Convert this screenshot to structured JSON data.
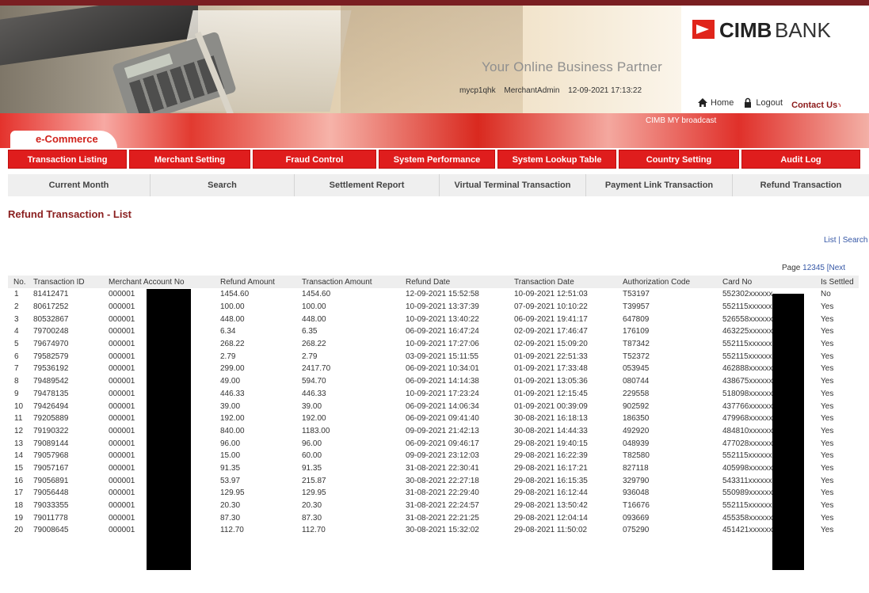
{
  "header": {
    "tagline": "Your Online Business Partner",
    "user_id": "mycp1qhk",
    "user_role": "MerchantAdmin",
    "datetime": "12-09-2021 17:13:22",
    "brand_name_bold": "CIMB",
    "brand_name_rest": "BANK",
    "links": {
      "home": "Home",
      "logout": "Logout",
      "contact": "Contact Us"
    }
  },
  "banner": {
    "section_tab": "e-Commerce",
    "broadcast": "CIMB MY broadcast"
  },
  "main_nav": [
    "Transaction Listing",
    "Merchant Setting",
    "Fraud Control",
    "System Performance",
    "System Lookup Table",
    "Country Setting",
    "Audit Log"
  ],
  "sub_nav": [
    "Current Month",
    "Search",
    "Settlement Report",
    "Virtual Terminal Transaction",
    "Payment Link Transaction",
    "Refund Transaction"
  ],
  "page": {
    "title": "Refund Transaction - List",
    "list_link": "List",
    "separator": " | ",
    "search_link": "Search",
    "pager_label": "Page",
    "pages": [
      "1",
      "2",
      "3",
      "4",
      "5"
    ],
    "next": "[Next"
  },
  "table": {
    "columns": [
      "No.",
      "Transaction ID",
      "Merchant Account No",
      "Refund Amount",
      "Transaction Amount",
      "Refund Date",
      "Transaction Date",
      "Authorization Code",
      "Card No",
      "Is Settled"
    ],
    "rows": [
      [
        "1",
        "81412471",
        "000001",
        "1454.60",
        "1454.60",
        "12-09-2021 15:52:58",
        "10-09-2021 12:51:03",
        "T53197",
        "552302xxxxxx",
        "No"
      ],
      [
        "2",
        "80617252",
        "000001",
        "100.00",
        "100.00",
        "10-09-2021 13:37:39",
        "07-09-2021 10:10:22",
        "T39957",
        "552115xxxxxx",
        "Yes"
      ],
      [
        "3",
        "80532867",
        "000001",
        "448.00",
        "448.00",
        "10-09-2021 13:40:22",
        "06-09-2021 19:41:17",
        "647809",
        "526558xxxxxx",
        "Yes"
      ],
      [
        "4",
        "79700248",
        "000001",
        "6.34",
        "6.35",
        "06-09-2021 16:47:24",
        "02-09-2021 17:46:47",
        "176109",
        "463225xxxxxx",
        "Yes"
      ],
      [
        "5",
        "79674970",
        "000001",
        "268.22",
        "268.22",
        "10-09-2021 17:27:06",
        "02-09-2021 15:09:20",
        "T87342",
        "552115xxxxxx",
        "Yes"
      ],
      [
        "6",
        "79582579",
        "000001",
        "2.79",
        "2.79",
        "03-09-2021 15:11:55",
        "01-09-2021 22:51:33",
        "T52372",
        "552115xxxxxx",
        "Yes"
      ],
      [
        "7",
        "79536192",
        "000001",
        "299.00",
        "2417.70",
        "06-09-2021 10:34:01",
        "01-09-2021 17:33:48",
        "053945",
        "462888xxxxxx",
        "Yes"
      ],
      [
        "8",
        "79489542",
        "000001",
        "49.00",
        "594.70",
        "06-09-2021 14:14:38",
        "01-09-2021 13:05:36",
        "080744",
        "438675xxxxxx",
        "Yes"
      ],
      [
        "9",
        "79478135",
        "000001",
        "446.33",
        "446.33",
        "10-09-2021 17:23:24",
        "01-09-2021 12:15:45",
        "229558",
        "518098xxxxxx",
        "Yes"
      ],
      [
        "10",
        "79426494",
        "000001",
        "39.00",
        "39.00",
        "06-09-2021 14:06:34",
        "01-09-2021 00:39:09",
        "902592",
        "437766xxxxxx",
        "Yes"
      ],
      [
        "11",
        "79205889",
        "000001",
        "192.00",
        "192.00",
        "06-09-2021 09:41:40",
        "30-08-2021 16:18:13",
        "186350",
        "479968xxxxxx",
        "Yes"
      ],
      [
        "12",
        "79190322",
        "000001",
        "840.00",
        "1183.00",
        "09-09-2021 21:42:13",
        "30-08-2021 14:44:33",
        "492920",
        "484810xxxxxx",
        "Yes"
      ],
      [
        "13",
        "79089144",
        "000001",
        "96.00",
        "96.00",
        "06-09-2021 09:46:17",
        "29-08-2021 19:40:15",
        "048939",
        "477028xxxxxx",
        "Yes"
      ],
      [
        "14",
        "79057968",
        "000001",
        "15.00",
        "60.00",
        "09-09-2021 23:12:03",
        "29-08-2021 16:22:39",
        "T82580",
        "552115xxxxxx",
        "Yes"
      ],
      [
        "15",
        "79057167",
        "000001",
        "91.35",
        "91.35",
        "31-08-2021 22:30:41",
        "29-08-2021 16:17:21",
        "827118",
        "405998xxxxxx",
        "Yes"
      ],
      [
        "16",
        "79056891",
        "000001",
        "53.97",
        "215.87",
        "30-08-2021 22:27:18",
        "29-08-2021 16:15:35",
        "329790",
        "543311xxxxxx",
        "Yes"
      ],
      [
        "17",
        "79056448",
        "000001",
        "129.95",
        "129.95",
        "31-08-2021 22:29:40",
        "29-08-2021 16:12:44",
        "936048",
        "550989xxxxxx",
        "Yes"
      ],
      [
        "18",
        "79033355",
        "000001",
        "20.30",
        "20.30",
        "31-08-2021 22:24:57",
        "29-08-2021 13:50:42",
        "T16676",
        "552115xxxxxx",
        "Yes"
      ],
      [
        "19",
        "79011778",
        "000001",
        "87.30",
        "87.30",
        "31-08-2021 22:21:25",
        "29-08-2021 12:04:14",
        "093669",
        "455358xxxxxx",
        "Yes"
      ],
      [
        "20",
        "79008645",
        "000001",
        "112.70",
        "112.70",
        "30-08-2021 15:32:02",
        "29-08-2021 11:50:02",
        "075290",
        "451421xxxxxx",
        "Yes"
      ]
    ]
  },
  "colors": {
    "brand_red": "#df1d1d",
    "title_red": "#8a1f1f",
    "link_blue": "#3557a6"
  }
}
